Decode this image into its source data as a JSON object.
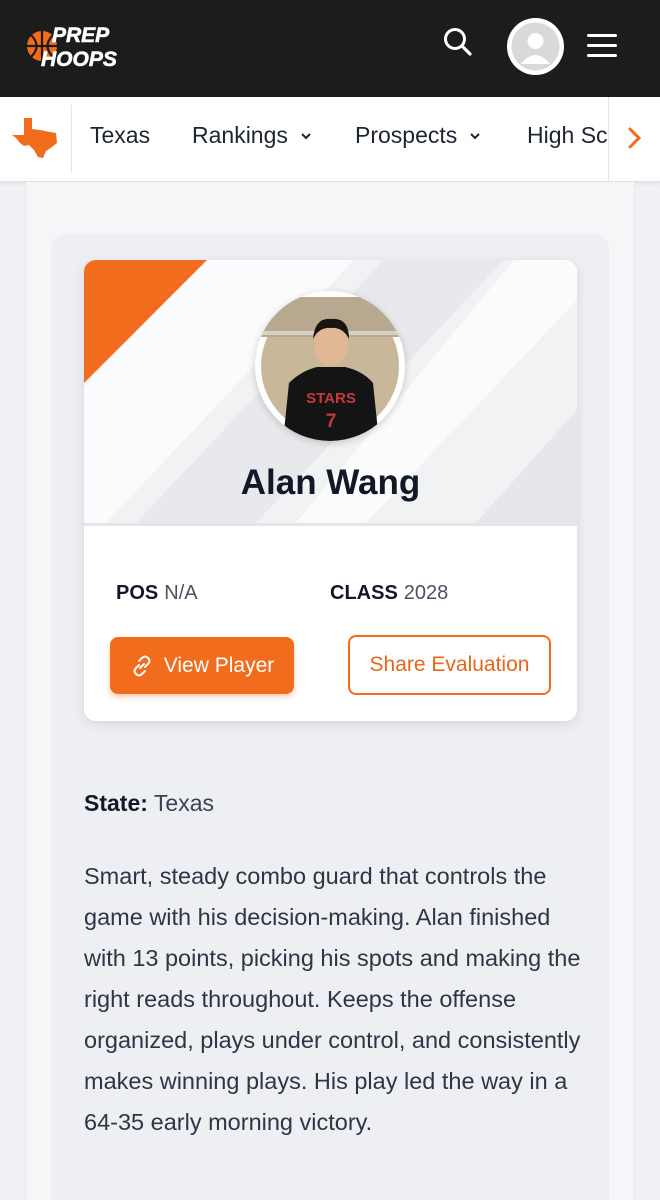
{
  "header": {
    "logo_line1": "PREP",
    "logo_line2": "HOOPS",
    "search_icon": "search-icon",
    "avatar_icon": "user-avatar-icon",
    "menu_icon": "hamburger-menu-icon"
  },
  "subnav": {
    "state_icon": "texas-state-icon",
    "items": [
      {
        "label": "Texas"
      },
      {
        "label": "Rankings"
      },
      {
        "label": "Prospects"
      },
      {
        "label": "High Sc"
      }
    ],
    "scroll_icon": "chevron-right-icon"
  },
  "card": {
    "player_name": "Alan Wang",
    "jersey_text": "STARS",
    "jersey_number": "7",
    "pos_label": "POS",
    "pos_value": "N/A",
    "class_label": "CLASS",
    "class_value": "2028",
    "view_button": "View Player",
    "share_button": "Share Evaluation"
  },
  "details": {
    "state_label": "State:",
    "state_value": "Texas",
    "evaluation": "Smart, steady combo guard that controls the game with his decision-making. Alan finished with 13 points, picking his spots and making the right reads throughout. Keeps the offense organized, plays under control, and consistently makes winning plays. His play led the way in a 64-35 early morning victory."
  },
  "colors": {
    "accent": "#f26c1e",
    "header_bg": "#1c1c1c",
    "text_dark": "#111827"
  }
}
